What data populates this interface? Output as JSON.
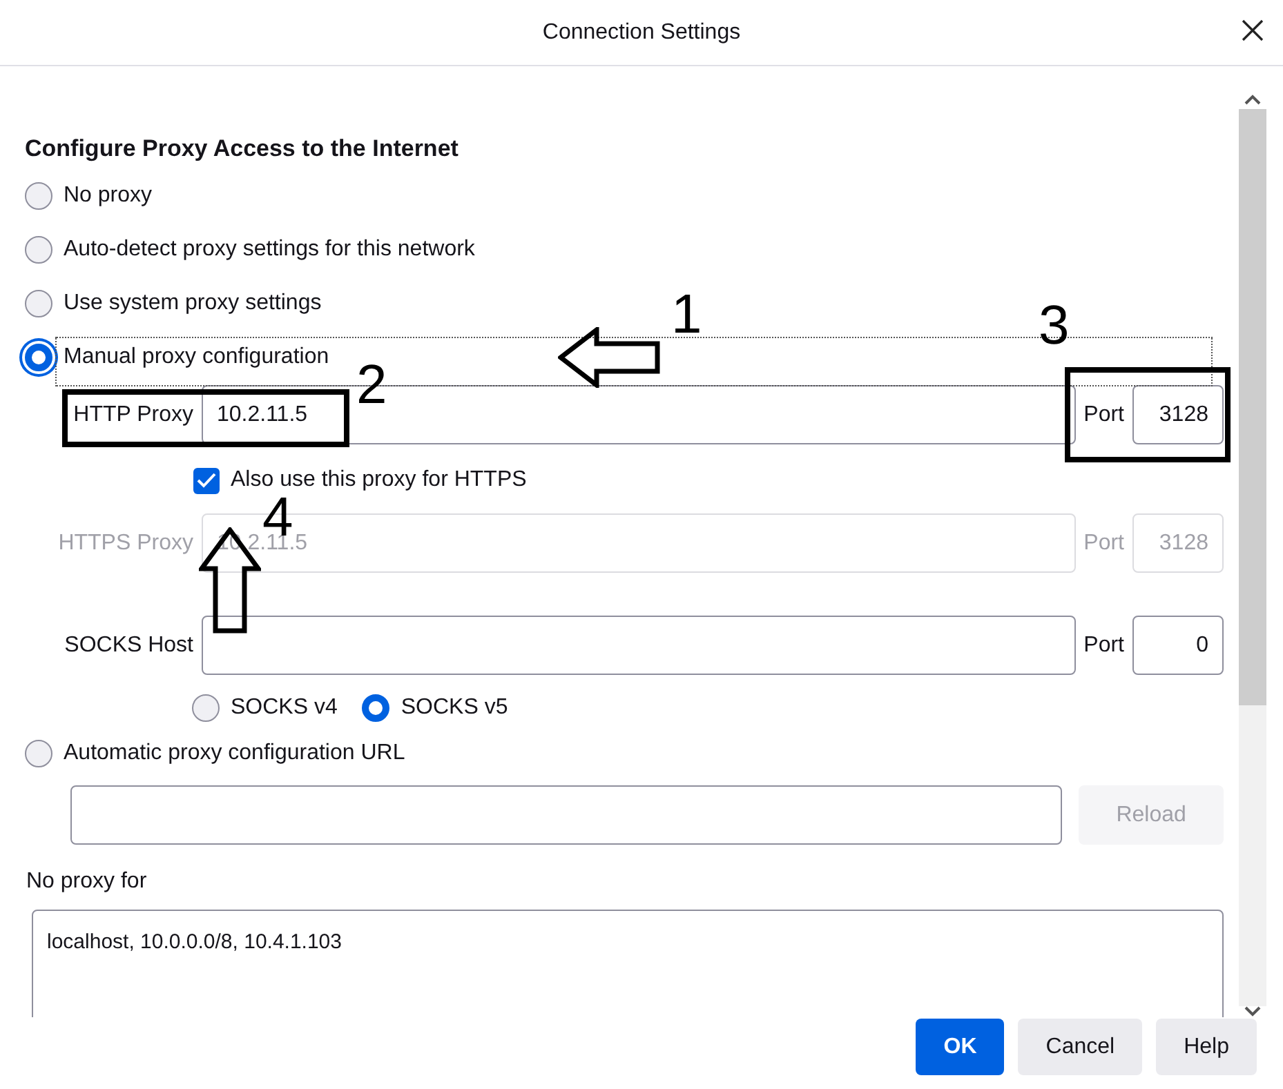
{
  "window": {
    "title": "Connection Settings"
  },
  "heading": "Configure Proxy Access to the Internet",
  "proxy_modes": [
    {
      "label": "No proxy",
      "selected": false
    },
    {
      "label": "Auto-detect proxy settings for this network",
      "selected": false
    },
    {
      "label": "Use system proxy settings",
      "selected": false
    },
    {
      "label": "Manual proxy configuration",
      "selected": true
    },
    {
      "label": "Automatic proxy configuration URL",
      "selected": false
    }
  ],
  "manual": {
    "proxies": [
      {
        "label": "HTTP Proxy",
        "value": "10.2.11.5",
        "port_label": "Port",
        "port": "3128",
        "disabled": false
      },
      {
        "label": "HTTPS Proxy",
        "value": "10.2.11.5",
        "port_label": "Port",
        "port": "3128",
        "disabled": true
      },
      {
        "label": "SOCKS Host",
        "port_label": "Port",
        "port": "0",
        "disabled": false
      }
    ],
    "also_https": {
      "label": "Also use this proxy for HTTPS",
      "checked": true
    },
    "socks_versions": [
      {
        "label": "SOCKS v4",
        "selected": false
      },
      {
        "label": "SOCKS v5",
        "selected": true
      }
    ]
  },
  "auto_url": {
    "reload": {
      "label": "Reload",
      "disabled": true
    }
  },
  "no_proxy": {
    "label": "No proxy for",
    "value": "localhost, 10.0.0.0/8, 10.4.1.103"
  },
  "buttons": [
    {
      "label": "OK",
      "kind": "primary"
    },
    {
      "label": "Cancel",
      "kind": "default"
    },
    {
      "label": "Help",
      "kind": "default"
    }
  ],
  "annotations": [
    {
      "kind": "arrow",
      "label": "1"
    },
    {
      "kind": "box",
      "label": "2"
    },
    {
      "kind": "box",
      "label": "3"
    },
    {
      "kind": "arrow",
      "label": "4"
    }
  ]
}
